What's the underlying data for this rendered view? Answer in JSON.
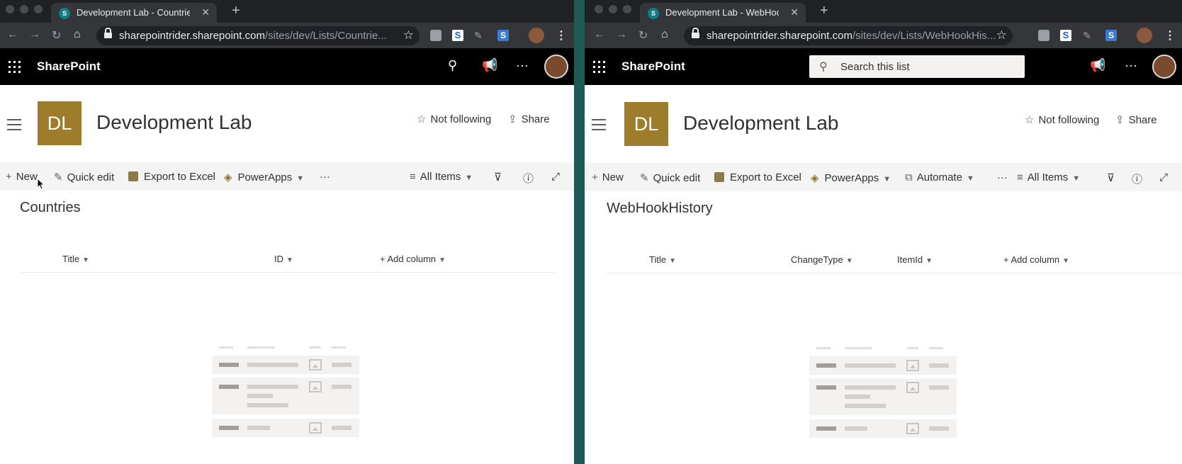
{
  "left": {
    "tab_title": "Development Lab - Countries",
    "url_host": "sharepointrider.sharepoint.com",
    "url_path": "/sites/dev/Lists/Countrie...",
    "suite_brand": "SharePoint",
    "site_logo": "DL",
    "site_title": "Development Lab",
    "follow_label": "Not following",
    "share_label": "Share",
    "commands": {
      "new": "New",
      "quick_edit": "Quick edit",
      "export": "Export to Excel",
      "powerapps": "PowerApps",
      "more": "···",
      "view": "All Items"
    },
    "list_title": "Countries",
    "columns": [
      "Title",
      "ID",
      "Add column"
    ]
  },
  "right": {
    "tab_title": "Development Lab - WebHookH",
    "url_host": "sharepointrider.sharepoint.com",
    "url_path": "/sites/dev/Lists/WebHookHis...",
    "suite_brand": "SharePoint",
    "search_placeholder": "Search this list",
    "site_logo": "DL",
    "site_title": "Development Lab",
    "follow_label": "Not following",
    "share_label": "Share",
    "commands": {
      "new": "New",
      "quick_edit": "Quick edit",
      "export": "Export to Excel",
      "powerapps": "PowerApps",
      "automate": "Automate",
      "more": "···",
      "view": "All Items"
    },
    "list_title": "WebHookHistory",
    "columns": [
      "Title",
      "ChangeType",
      "ItemId",
      "Add column"
    ]
  },
  "icons": [
    "back-icon",
    "forward-icon",
    "reload-icon",
    "home-icon",
    "lock-icon",
    "star-icon",
    "waffle-icon",
    "search-icon",
    "megaphone-icon",
    "more-icon",
    "filter-icon",
    "info-icon",
    "expand-icon"
  ],
  "colors": {
    "site_logo": "#9d7c2b",
    "suite_bar": "#000000",
    "command_bar": "#f4f4f4",
    "divider": "#1f5b56"
  }
}
